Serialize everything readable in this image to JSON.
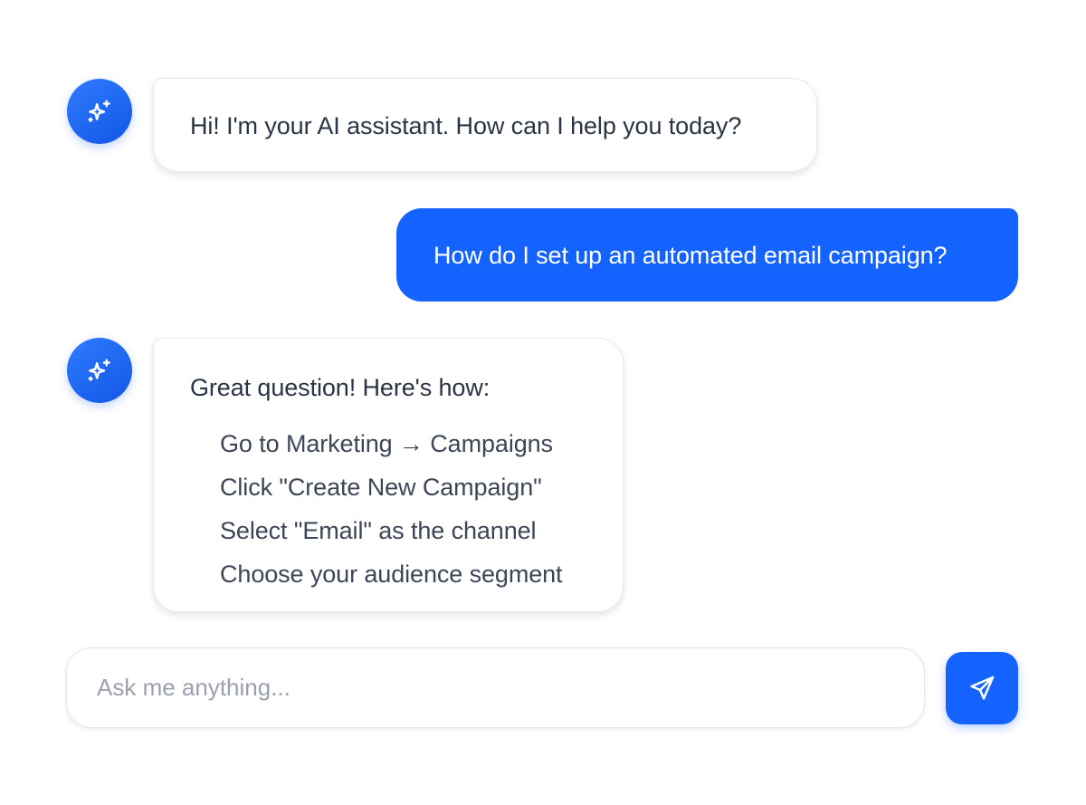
{
  "conversation": {
    "messages": [
      {
        "role": "assistant",
        "text": "Hi! I'm your AI assistant. How can I help you today?"
      },
      {
        "role": "user",
        "text": "How do I set up an automated email campaign?"
      },
      {
        "role": "assistant",
        "text": "Great question! Here's how:",
        "steps": [
          "Go to Marketing → Campaigns",
          "Click \"Create New Campaign\"",
          "Select \"Email\" as the channel",
          "Choose your audience segment"
        ]
      }
    ]
  },
  "composer": {
    "placeholder": "Ask me anything...",
    "send_icon": "send-icon"
  },
  "avatar_icon": "sparkle-icon",
  "colors": {
    "accent": "#1463ff",
    "assistant_text": "#2a3444",
    "bubble_border": "#e6e8ec",
    "placeholder": "#9aa1ad"
  }
}
